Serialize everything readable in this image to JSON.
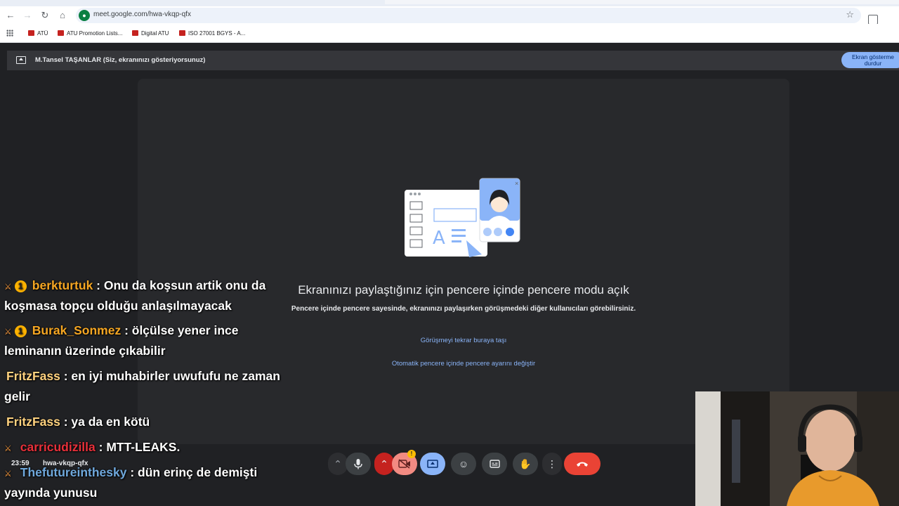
{
  "browser": {
    "url": "meet.google.com/hwa-vkqp-qfx",
    "bookmarks": [
      {
        "label": "ATÜ"
      },
      {
        "label": "ATU Promotion Lists..."
      },
      {
        "label": "Digital ATU"
      },
      {
        "label": "ISO 27001 BGYS - A..."
      }
    ]
  },
  "meet": {
    "banner_text": "M.Tansel TAŞANLAR (Siz, ekranınızı gösteriyorsunuz)",
    "stop_sharing_line1": "Ekran gösterme",
    "stop_sharing_line2": "durdur",
    "pip_title": "Ekranınızı paylaştığınız için pencere içinde pencere modu açık",
    "pip_description": "Pencere içinde pencere sayesinde, ekranınızı paylaşırken görüşmedeki diğer kullanıcıları görebilirsiniz.",
    "move_meeting_link": "Görüşmeyi tekrar buraya taşı",
    "auto_pip_link": "Otomatik pencere içinde pencere ayarını değiştir",
    "time": "23:59",
    "meeting_code": "hwa-vkqp-qfx"
  },
  "chat": {
    "messages": [
      {
        "user": "berkturtuk",
        "user_color": "#f5a623",
        "line1": " : Onu da koşsun artik onu da",
        "line2": "koşmasa topçu olduğu anlaşılmayacak",
        "has_badge": true
      },
      {
        "user": "Burak_Sonmez",
        "user_color": "#f5a623",
        "line1": " : ölçülse yener ince",
        "line2": "leminanın üzerinde çıkabilir",
        "has_badge": true
      },
      {
        "user": "FritzFass",
        "user_color": "#ffd27f",
        "line1": " : en iyi muhabirler uwufufu ne zaman",
        "line2": "gelir",
        "has_badge": false
      },
      {
        "user": "FritzFass",
        "user_color": "#ffd27f",
        "line1": " : ya da en kötü",
        "line2": "",
        "has_badge": false
      },
      {
        "user": "carricudizilla",
        "user_color": "#e8303a",
        "line1": " : MTT-LEAKS.",
        "line2": "",
        "has_badge": false
      },
      {
        "user": "Thefutureinthesky",
        "user_color": "#6fa8dc",
        "line1": " : dün erinç de demişti",
        "line2": "yayında yunusu",
        "has_badge": false
      }
    ]
  },
  "colors": {
    "meet_bg": "#202124",
    "accent_blue": "#8ab4f8",
    "end_call_red": "#ea4335"
  }
}
